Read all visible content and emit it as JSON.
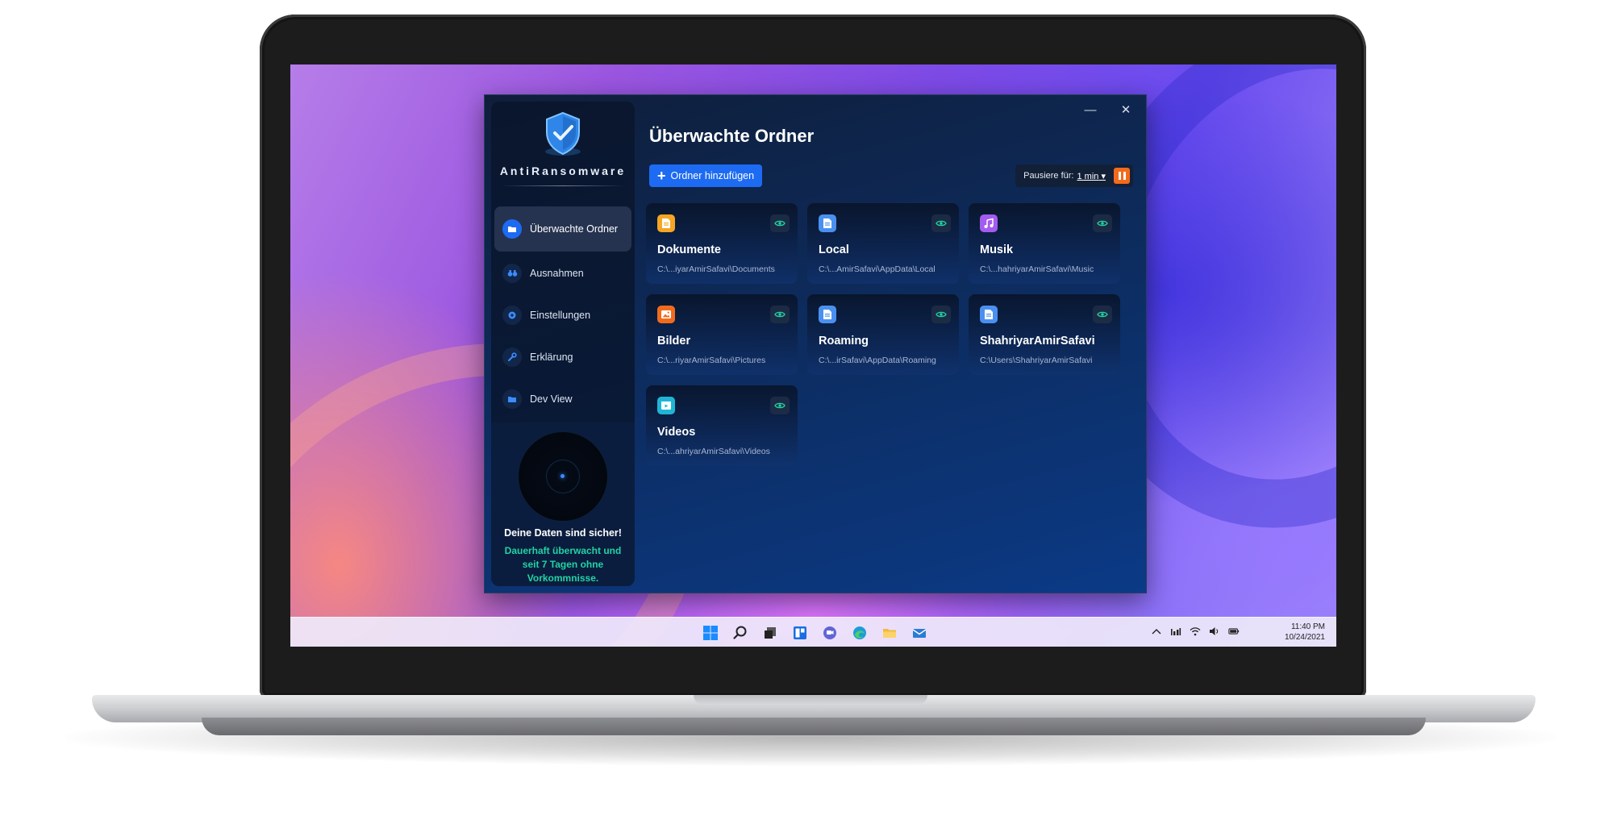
{
  "window": {
    "minimize_glyph": "—",
    "close_glyph": "✕"
  },
  "sidebar": {
    "brand": "AntiRansomware",
    "items": [
      {
        "label": "Überwachte Ordner",
        "icon": "folder-icon",
        "active": true
      },
      {
        "label": "Ausnahmen",
        "icon": "binoculars-icon",
        "active": false
      },
      {
        "label": "Einstellungen",
        "icon": "gear-icon",
        "active": false
      },
      {
        "label": "Erklärung",
        "icon": "wrench-icon",
        "active": false
      },
      {
        "label": "Dev View",
        "icon": "folder-icon",
        "active": false
      }
    ],
    "status": {
      "title": "Deine Daten sind sicher!",
      "subtitle": "Dauerhaft überwacht und seit 7 Tagen ohne Vorkommnisse."
    }
  },
  "main": {
    "title": "Überwachte Ordner",
    "add_button": "Ordner hinzufügen",
    "pause": {
      "label": "Pausiere für:",
      "selected": "1 min"
    },
    "folders": [
      {
        "name": "Dokumente",
        "path": "C:\\...iyarAmirSafavi\\Documents",
        "icon": "document-icon",
        "color": "#f5a623"
      },
      {
        "name": "Local",
        "path": "C:\\...AmirSafavi\\AppData\\Local",
        "icon": "document-icon",
        "color": "#4a90f0"
      },
      {
        "name": "Musik",
        "path": "C:\\...hahriyarAmirSafavi\\Music",
        "icon": "music-icon",
        "color": "#a35cf0"
      },
      {
        "name": "Bilder",
        "path": "C:\\...riyarAmirSafavi\\Pictures",
        "icon": "image-icon",
        "color": "#f26b1d"
      },
      {
        "name": "Roaming",
        "path": "C:\\...irSafavi\\AppData\\Roaming",
        "icon": "document-icon",
        "color": "#4a90f0"
      },
      {
        "name": "ShahriyarAmirSafavi",
        "path": "C:\\Users\\ShahriyarAmirSafavi",
        "icon": "document-icon",
        "color": "#4a90f0"
      },
      {
        "name": "Videos",
        "path": "C:\\...ahriyarAmirSafavi\\Videos",
        "icon": "video-icon",
        "color": "#1fb6d6"
      }
    ]
  },
  "taskbar": {
    "time": "11:40 PM",
    "date": "10/24/2021"
  }
}
